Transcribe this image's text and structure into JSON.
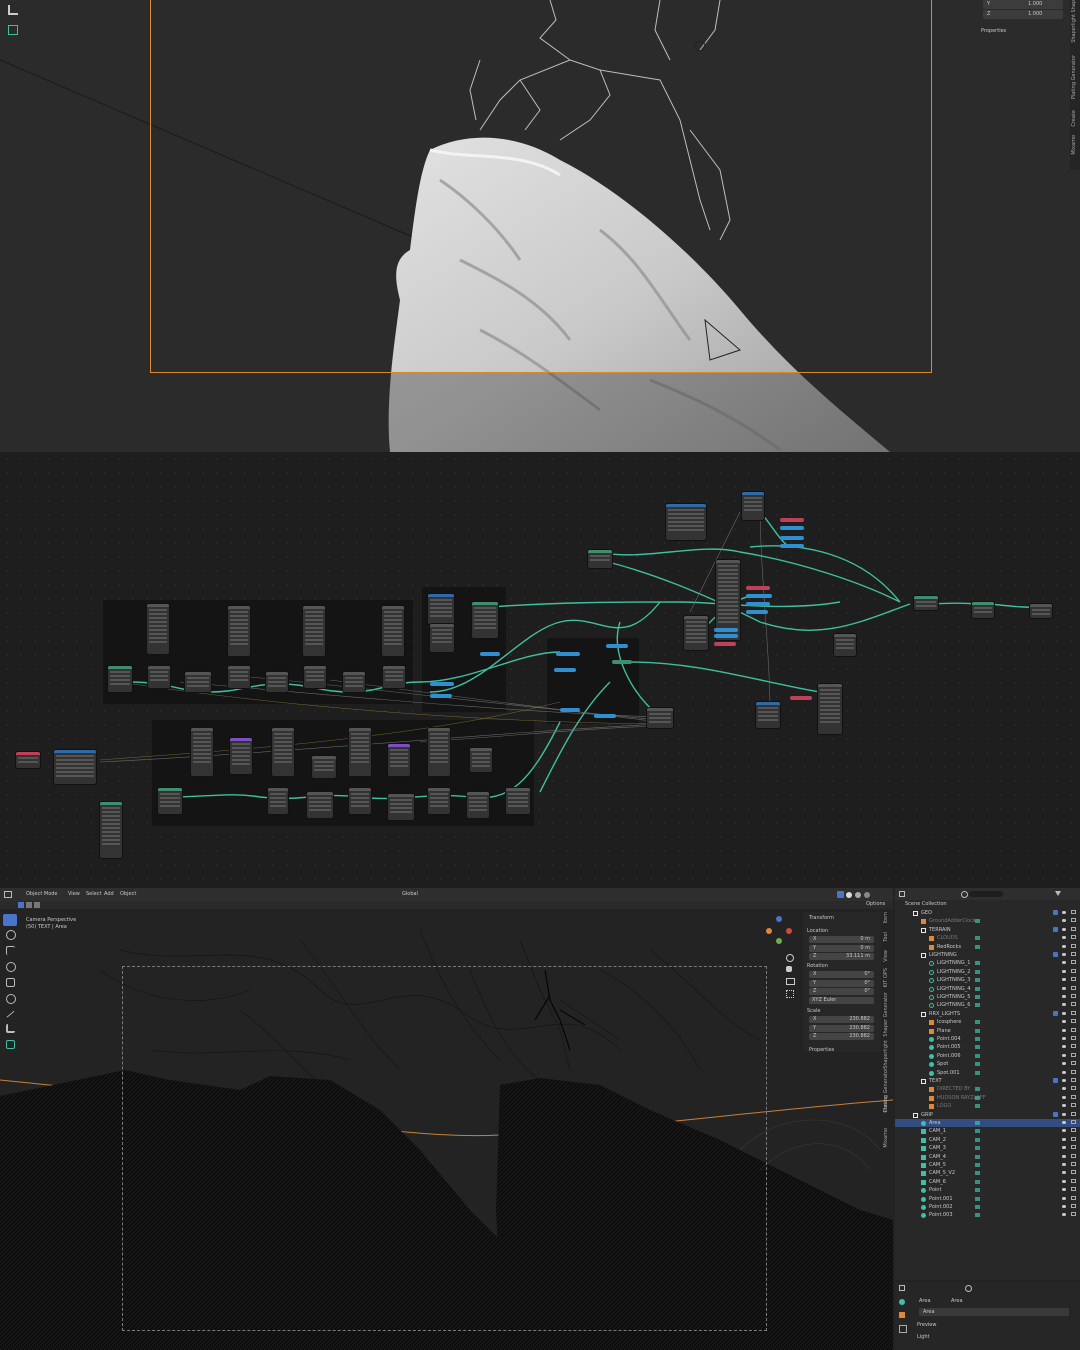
{
  "colors": {
    "camera_frame": "#d98a2e",
    "node_link": "#3fbf9f",
    "node_link_alt": "#2fae8c",
    "selected_row": "#334d80",
    "accent": "#4a74c9",
    "collection_icon": "#e8e8e8",
    "object_orange": "#e0883a",
    "modifier_teal": "#3fbfa7"
  },
  "top_viewport": {
    "n_panel": {
      "rows": [
        {
          "axis": "Y",
          "value": "1.000"
        },
        {
          "axis": "Z",
          "value": "1.000"
        }
      ],
      "section": "Properties"
    },
    "sidebar_tabs": [
      "Shap",
      "Shaperlight",
      "Plating Generator",
      "Create",
      "Mixamo"
    ]
  },
  "bottom_editor": {
    "header": {
      "mode": "Object Mode",
      "menus": [
        "View",
        "Select",
        "Add",
        "Object"
      ],
      "orientation": "Global",
      "options": "Options"
    },
    "viewport_info": {
      "line1": "Camera Perspective",
      "line2": "(50) TEXT | Area"
    },
    "n_panel": {
      "title": "Transform",
      "location_label": "Location",
      "location": [
        {
          "axis": "X",
          "value": "0 m"
        },
        {
          "axis": "Y",
          "value": "0 m"
        },
        {
          "axis": "Z",
          "value": "33.111 m"
        }
      ],
      "rotation_label": "Rotation",
      "rotation": [
        {
          "axis": "X",
          "value": "0°"
        },
        {
          "axis": "Y",
          "value": "0°"
        },
        {
          "axis": "Z",
          "value": "0°"
        }
      ],
      "rotation_mode": "XYZ Euler",
      "scale_label": "Scale",
      "scale": [
        {
          "axis": "X",
          "value": "230.882"
        },
        {
          "axis": "Y",
          "value": "230.882"
        },
        {
          "axis": "Z",
          "value": "230.882"
        }
      ],
      "properties": "Properties"
    },
    "sidebar_tabs": [
      "Item",
      "Tool",
      "View",
      "KIT OPS",
      "Shaper Generator",
      "Shaperlight",
      "Plating Generator",
      "Create",
      "Mixamo"
    ]
  },
  "outliner": {
    "root": "Scene Collection",
    "rows": [
      {
        "name": "GEO",
        "indent": 1,
        "type": "collection"
      },
      {
        "name": "GroundAdderClock",
        "indent": 2,
        "type": "object",
        "dim": true
      },
      {
        "name": "TERRAIN",
        "indent": 2,
        "type": "collection"
      },
      {
        "name": "CLOUDS",
        "indent": 3,
        "type": "object",
        "dim": true
      },
      {
        "name": "RedRocks",
        "indent": 3,
        "type": "object"
      },
      {
        "name": "LIGHTNING",
        "indent": 2,
        "type": "collection"
      },
      {
        "name": "LIGHTNING_1",
        "indent": 3,
        "type": "curve"
      },
      {
        "name": "LIGHTNING_2",
        "indent": 3,
        "type": "curve"
      },
      {
        "name": "LIGHTNING_3",
        "indent": 3,
        "type": "curve"
      },
      {
        "name": "LIGHTNING_4",
        "indent": 3,
        "type": "curve"
      },
      {
        "name": "LIGHTNING_5",
        "indent": 3,
        "type": "curve"
      },
      {
        "name": "LIGHTNING_6",
        "indent": 3,
        "type": "curve"
      },
      {
        "name": "RRX_LIGHTS",
        "indent": 2,
        "type": "collection"
      },
      {
        "name": "Icosphere",
        "indent": 3,
        "type": "object"
      },
      {
        "name": "Plane",
        "indent": 3,
        "type": "object"
      },
      {
        "name": "Point.004",
        "indent": 3,
        "type": "light"
      },
      {
        "name": "Point.005",
        "indent": 3,
        "type": "light"
      },
      {
        "name": "Point.006",
        "indent": 3,
        "type": "light"
      },
      {
        "name": "Spot",
        "indent": 3,
        "type": "light"
      },
      {
        "name": "Spot.001",
        "indent": 3,
        "type": "light"
      },
      {
        "name": "TEXT",
        "indent": 2,
        "type": "collection"
      },
      {
        "name": "DIRECTED BY",
        "indent": 3,
        "type": "object",
        "dim": true
      },
      {
        "name": "HUDSON RAYZLAFF",
        "indent": 3,
        "type": "object",
        "dim": true
      },
      {
        "name": "LOGO",
        "indent": 3,
        "type": "object",
        "dim": true
      },
      {
        "name": "GRIP",
        "indent": 1,
        "type": "collection"
      },
      {
        "name": "Area",
        "indent": 2,
        "type": "light",
        "selected": true
      },
      {
        "name": "CAM_1",
        "indent": 2,
        "type": "camera"
      },
      {
        "name": "CAM_2",
        "indent": 2,
        "type": "camera"
      },
      {
        "name": "CAM_3",
        "indent": 2,
        "type": "camera"
      },
      {
        "name": "CAM_4",
        "indent": 2,
        "type": "camera"
      },
      {
        "name": "CAM_5",
        "indent": 2,
        "type": "camera"
      },
      {
        "name": "CAM_5_V2",
        "indent": 2,
        "type": "camera"
      },
      {
        "name": "CAM_6",
        "indent": 2,
        "type": "camera"
      },
      {
        "name": "Point",
        "indent": 2,
        "type": "light"
      },
      {
        "name": "Point.001",
        "indent": 2,
        "type": "light"
      },
      {
        "name": "Point.002",
        "indent": 2,
        "type": "light"
      },
      {
        "name": "Point.003",
        "indent": 2,
        "type": "light"
      }
    ]
  },
  "properties_panel": {
    "breadcrumb_object": "Area",
    "breadcrumb_data": "Area",
    "data_name": "Area",
    "section_preview": "Preview",
    "section_light": "Light"
  }
}
